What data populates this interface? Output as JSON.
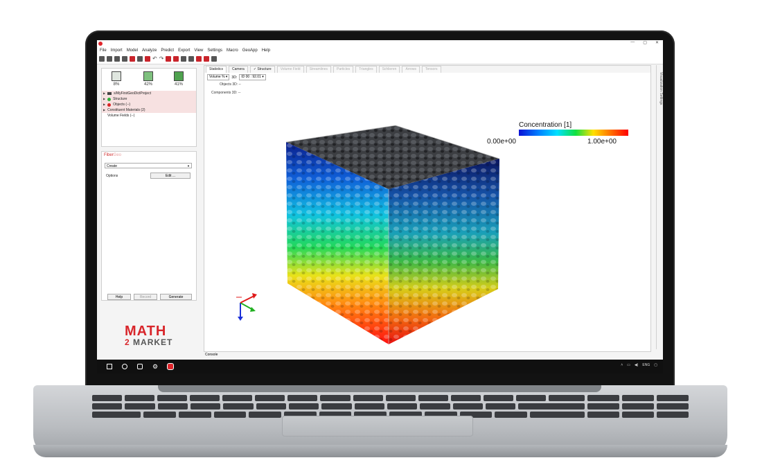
{
  "window": {
    "controls": [
      "—",
      "▢",
      "✕"
    ]
  },
  "menu": [
    "File",
    "Import",
    "Model",
    "Analyze",
    "Predict",
    "Export",
    "View",
    "Settings",
    "Macro",
    "GeoApp",
    "Help"
  ],
  "stats": [
    {
      "value": "8%"
    },
    {
      "value": "42%"
    },
    {
      "value": "41%"
    }
  ],
  "tree": {
    "project": "s/MyFirstGeoDictProject",
    "structure": "Structure",
    "objects": "Objects (--)",
    "constituent": "Constituent Materials (2)",
    "volume_fields": "Volume Fields (--)"
  },
  "fibergeo": {
    "title_part1": "Fiber",
    "title_part2": "Geo",
    "mode": "Create",
    "options_label": "Options",
    "edit_button": "Edit ...",
    "help_button": "Help",
    "record_button": "Record",
    "generate_button": "Generate"
  },
  "brand": {
    "line1": "MATH",
    "line2_num": "2",
    "line2_word": "MARKET"
  },
  "tabs": [
    {
      "label": "Statistics"
    },
    {
      "label": "Camera"
    },
    {
      "label": "✓ Structure"
    },
    {
      "label": "Volume Field"
    },
    {
      "label": "Streamlines"
    },
    {
      "label": "Particles"
    },
    {
      "label": "Triangles"
    },
    {
      "label": "Schlieren"
    },
    {
      "label": "Arrows"
    },
    {
      "label": "Tensors"
    }
  ],
  "controls": {
    "volume_select": "Volume %",
    "three_d_label": "3D:",
    "three_d_value": "ID 00 : 92.01",
    "objects_line": "Objects 3D: --",
    "components_line": "Components 3D: --"
  },
  "legend": {
    "title": "Concentration [1]",
    "min": "0.00e+00",
    "max": "1.00e+00"
  },
  "side_panel_label": "Visualization Settings",
  "console_label": "Console",
  "tray": {
    "lang": "ENG"
  },
  "colors": {
    "brand_red": "#d8262b",
    "taskbar": "#101010"
  }
}
